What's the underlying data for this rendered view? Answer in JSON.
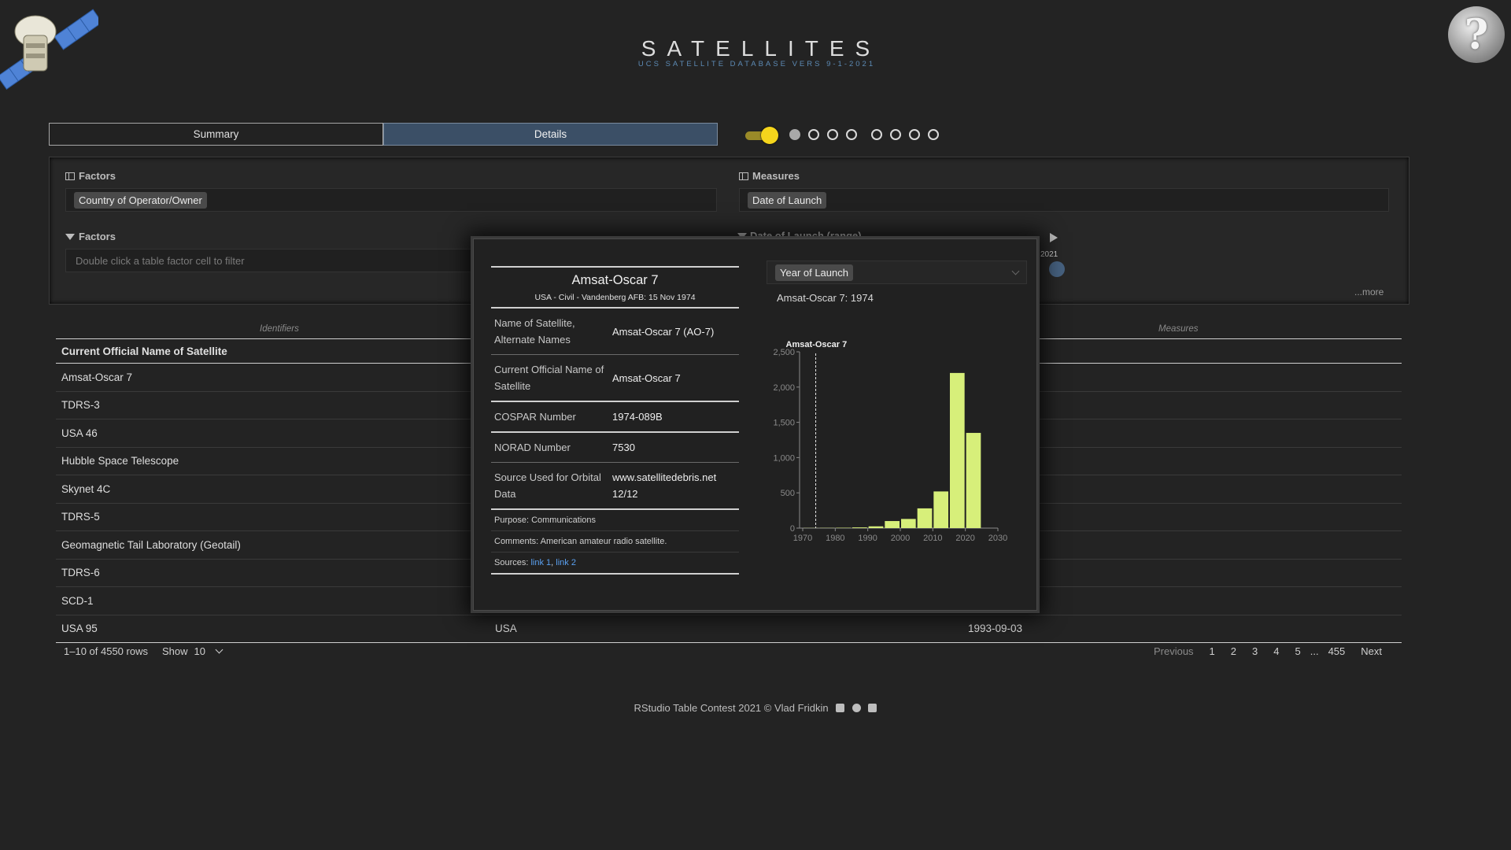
{
  "header": {
    "title": "SATELLITES",
    "subtitle": "UCS SATELLITE DATABASE VERS 9-1-2021",
    "help_glyph": "?"
  },
  "tabs": [
    {
      "label": "Summary",
      "active": false
    },
    {
      "label": "Details",
      "active": true
    }
  ],
  "toggle": {
    "on": true,
    "color": "#f5d51c"
  },
  "steps": {
    "total": 8,
    "current": 1
  },
  "controls": {
    "factors_label": "Factors",
    "factors_chip": "Country of Operator/Owner",
    "measures_label": "Measures",
    "measures_chip": "Date of Launch",
    "filter_label": "Factors",
    "filter_placeholder": "Double click a table factor cell to filter",
    "range_label": "Date of Launch (range)",
    "range_end_year": "2021",
    "more_label": "...more"
  },
  "table": {
    "group_headers": {
      "identifiers": "Identifiers",
      "measures": "Measures"
    },
    "columns": [
      "Current Official Name of Satellite"
    ],
    "rows": [
      {
        "name": "Amsat-Oscar 7",
        "country": "",
        "date": ""
      },
      {
        "name": "TDRS-3",
        "country": "",
        "date": ""
      },
      {
        "name": "USA 46",
        "country": "",
        "date": ""
      },
      {
        "name": "Hubble Space Telescope",
        "country": "",
        "date": ""
      },
      {
        "name": "Skynet 4C",
        "country": "",
        "date": ""
      },
      {
        "name": "TDRS-5",
        "country": "",
        "date": ""
      },
      {
        "name": "Geomagnetic Tail Laboratory (Geotail)",
        "country": "",
        "date": ""
      },
      {
        "name": "TDRS-6",
        "country": "",
        "date": ""
      },
      {
        "name": "SCD-1",
        "country": "",
        "date": ""
      },
      {
        "name": "USA 95",
        "country": "USA",
        "date": "1993-09-03"
      }
    ],
    "pagination": {
      "summary": "1–10 of 4550 rows",
      "show_label": "Show",
      "page_size": "10",
      "previous": "Previous",
      "pages": [
        "1",
        "2",
        "3",
        "4",
        "5",
        "...",
        "455"
      ],
      "next": "Next"
    }
  },
  "footer": {
    "text": "RStudio Table Contest 2021 © Vlad Fridkin",
    "icons": [
      "linkedin-icon",
      "github-icon",
      "youtube-icon"
    ]
  },
  "modal": {
    "title": "Amsat-Oscar 7",
    "subtitle": "USA - Civil - Vandenberg AFB: 15 Nov 1974",
    "fields": [
      {
        "key": "Name of Satellite, Alternate Names",
        "value": "Amsat-Oscar 7 (AO-7)"
      },
      {
        "key": "Current Official Name of Satellite",
        "value": "Amsat-Oscar 7"
      },
      {
        "key": "COSPAR Number",
        "value": "1974-089B"
      },
      {
        "key": "NORAD Number",
        "value": "7530"
      },
      {
        "key": "Source Used for Orbital Data",
        "value": "www.satellitedebris.net 12/12"
      }
    ],
    "purpose": "Purpose: Communications",
    "comments": "Comments: American amateur radio satellite.",
    "sources_label": "Sources:",
    "source_links": [
      "link 1",
      "link 2"
    ],
    "measure_select": "Year of Launch",
    "chart_caption": "Amsat-Oscar 7: 1974"
  },
  "chart_data": {
    "type": "bar",
    "x_bins": [
      1970,
      1975,
      1980,
      1985,
      1990,
      1995,
      2000,
      2005,
      2010,
      2015,
      2020,
      2025
    ],
    "values": [
      2,
      3,
      5,
      10,
      25,
      100,
      130,
      280,
      520,
      2200,
      1350,
      0
    ],
    "x_ticks": [
      1970,
      1980,
      1990,
      2000,
      2010,
      2020,
      2030
    ],
    "y_ticks": [
      0,
      500,
      1000,
      1500,
      2000,
      2500
    ],
    "y_tick_labels": [
      "0",
      "500",
      "1,000",
      "1,500",
      "2,000",
      "2,500"
    ],
    "xlim": [
      1970,
      2030
    ],
    "ylim": [
      0,
      2500
    ],
    "marker": {
      "label": "Amsat-Oscar 7",
      "x": 1974
    },
    "bar_color": "#d7ef7a",
    "axis_color": "#8a8a8a"
  }
}
